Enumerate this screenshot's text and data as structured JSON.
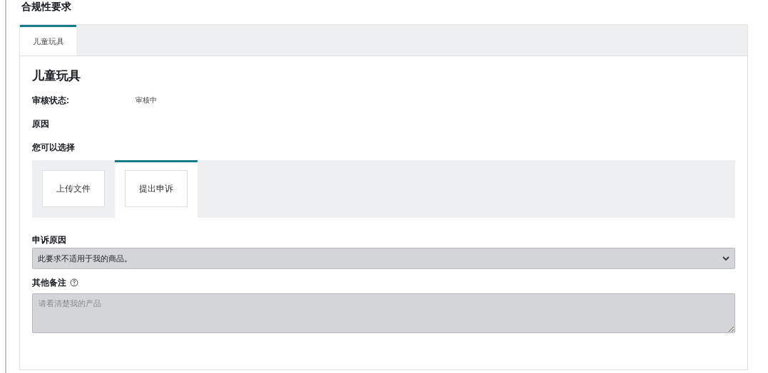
{
  "page_title": "合规性要求",
  "tabs": [
    {
      "label": "儿童玩具",
      "selected": true
    }
  ],
  "panel": {
    "heading": "儿童玩具",
    "status": {
      "label": "审核状态:",
      "value": "审核中"
    },
    "reason": {
      "label": "原因"
    },
    "choices": {
      "label": "您可以选择",
      "options": [
        {
          "label": "上传文件",
          "selected": false
        },
        {
          "label": "提出申诉",
          "selected": true
        }
      ]
    },
    "appeal_reason": {
      "label": "申诉原因",
      "value": "此要求不适用于我的商品。",
      "disabled": true
    },
    "notes": {
      "label": "其他备注",
      "placeholder": "请看清楚我的产品",
      "disabled": true
    }
  }
}
